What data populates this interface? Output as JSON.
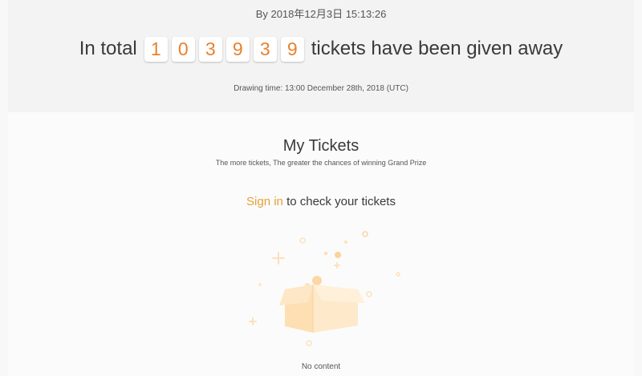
{
  "header": {
    "timestamp": "By 2018年12月3日 15:13:26",
    "total_prefix": "In total",
    "digits": [
      "1",
      "0",
      "3",
      "9",
      "3",
      "9"
    ],
    "total_suffix": "tickets have been given away",
    "drawing_time": "Drawing time: 13:00 December 28th, 2018 (UTC)"
  },
  "my_tickets": {
    "title": "My Tickets",
    "subtitle": "The more tickets, The greater the chances of winning Grand Prize",
    "sign_in_link": "Sign in",
    "sign_in_rest": " to check your tickets",
    "empty_icon": "empty-box-illustration",
    "empty_text": "No content"
  },
  "colors": {
    "accent": "#e8812e",
    "link": "#e6a133",
    "box": "#fde6c2"
  }
}
